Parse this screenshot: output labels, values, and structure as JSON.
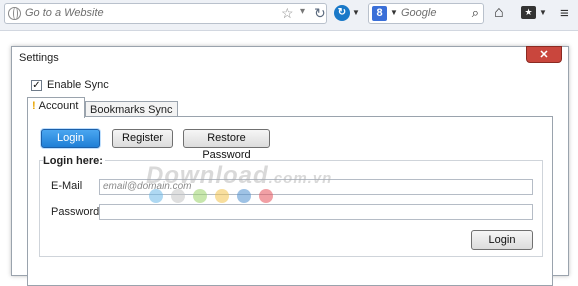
{
  "browser": {
    "url_placeholder": "Go to a Website",
    "search_placeholder": "Google",
    "search_engine_letter": "8"
  },
  "dialog": {
    "title": "Settings",
    "close_label": "✕",
    "enable_sync": {
      "label": "Enable Sync",
      "checked": true
    },
    "tabs": [
      {
        "label": "Account",
        "active": true,
        "warning_icon": "!"
      },
      {
        "label": "Bookmarks Sync",
        "active": false
      }
    ],
    "account": {
      "buttons": {
        "login": "Login",
        "register": "Register",
        "restore": "Restore Password"
      },
      "group_label": "Login here:",
      "email": {
        "label": "E-Mail",
        "placeholder": "email@domain.com",
        "value": ""
      },
      "password": {
        "label": "Password",
        "value": ""
      },
      "submit_label": "Login"
    }
  },
  "watermark": {
    "text": "Download",
    "suffix": ".com.vn",
    "dot_colors": [
      "#6bb8e8",
      "#c4c4c4",
      "#9bd36a",
      "#f2c24d",
      "#4f8fd0",
      "#e6505a"
    ]
  }
}
